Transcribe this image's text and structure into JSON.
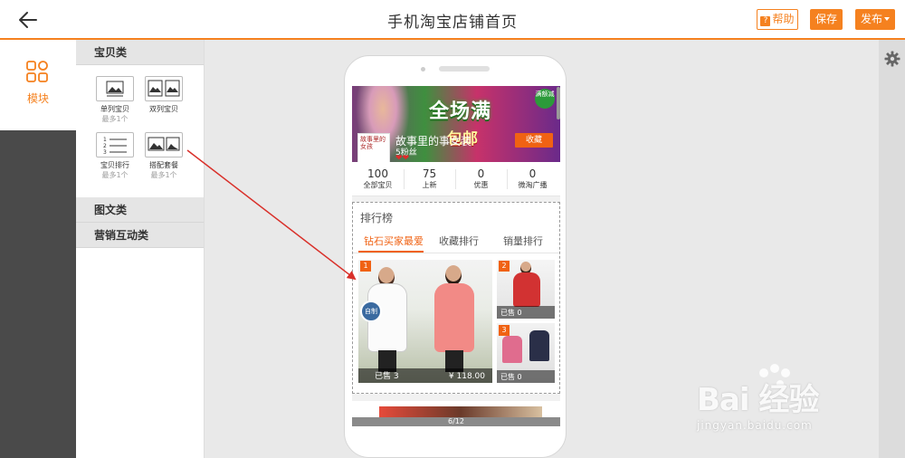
{
  "header": {
    "title": "手机淘宝店铺首页",
    "help_label": "帮助",
    "save_label": "保存",
    "publish_label": "发布"
  },
  "rail": {
    "active_label": "模块"
  },
  "panel": {
    "sections": [
      "宝贝类",
      "图文类",
      "营销互动类"
    ],
    "modules": [
      {
        "name": "单列宝贝",
        "limit": "最多1个"
      },
      {
        "name": "双列宝贝",
        "limit": ""
      },
      {
        "name": "宝贝排行",
        "limit": "最多1个"
      },
      {
        "name": "搭配套餐",
        "limit": "最多1个"
      }
    ]
  },
  "phone": {
    "banner": {
      "main_text": "全场满",
      "sub_text": "包邮",
      "badge": "满额减"
    },
    "shop": {
      "logo_text": "故事里的女孩",
      "name": "故事里的事女装",
      "fans": "5粉丝",
      "hearts": "❤❤",
      "follow_label": "收藏"
    },
    "stats": [
      {
        "num": "100",
        "label": "全部宝贝"
      },
      {
        "num": "75",
        "label": "上新"
      },
      {
        "num": "0",
        "label": "优惠"
      },
      {
        "num": "0",
        "label": "微淘广播"
      }
    ],
    "ranking": {
      "title": "排行榜",
      "tabs": [
        "钻石买家最爱",
        "收藏排行",
        "销量排行"
      ],
      "items": [
        {
          "rank": "1",
          "sold": "已售 3",
          "price": "¥ 118.00",
          "stamp": "自制"
        },
        {
          "rank": "2",
          "sold": "已售 0"
        },
        {
          "rank": "3",
          "sold": "已售 0"
        }
      ]
    },
    "page_indicator": "6/12"
  },
  "watermark": {
    "brand": "Bai 经验",
    "url": "jingyan.baidu.com"
  },
  "colors": {
    "accent": "#f5811f",
    "rail": "#4a4a4a",
    "arrow": "#d9302a"
  }
}
